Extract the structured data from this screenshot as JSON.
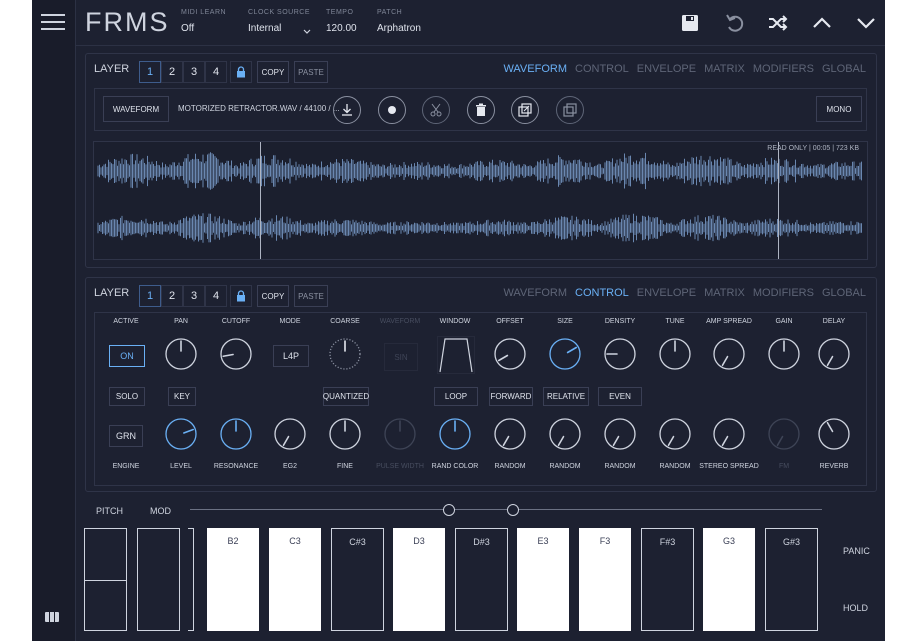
{
  "header": {
    "logo": "FRMS",
    "fields": [
      {
        "label": "MIDI LEARN",
        "value": "Off"
      },
      {
        "label": "CLOCK SOURCE",
        "value": "Internal"
      },
      {
        "label": "TEMPO",
        "value": "120.00"
      },
      {
        "label": "PATCH",
        "value": "Arphatron"
      }
    ]
  },
  "layer_top": {
    "label": "LAYER",
    "numbers": [
      "1",
      "2",
      "3",
      "4"
    ],
    "copy": "COPY",
    "paste": "PASTE",
    "tabs": [
      "WAVEFORM",
      "CONTROL",
      "ENVELOPE",
      "MATRIX",
      "MODIFIERS",
      "GLOBAL"
    ],
    "selected_tab": "WAVEFORM"
  },
  "waveform": {
    "button": "WAVEFORM",
    "file": "MOTORIZED RETRACTOR.WAV / 44100 / ...",
    "mono": "MONO",
    "info": "READ ONLY  |  00:05  |  723 KB"
  },
  "layer_bottom": {
    "label": "LAYER",
    "numbers": [
      "1",
      "2",
      "3",
      "4"
    ],
    "copy": "COPY",
    "paste": "PASTE",
    "tabs": [
      "WAVEFORM",
      "CONTROL",
      "ENVELOPE",
      "MATRIX",
      "MODIFIERS",
      "GLOBAL"
    ],
    "selected_tab": "CONTROL"
  },
  "control": {
    "top_labels": [
      "ACTIVE",
      "PAN",
      "CUTOFF",
      "MODE",
      "COARSE",
      "WAVEFORM",
      "WINDOW",
      "OFFSET",
      "SIZE",
      "DENSITY",
      "TUNE",
      "AMP SPREAD",
      "GAIN",
      "DELAY"
    ],
    "on": "ON",
    "mode": "L4P",
    "sin": "SIN",
    "solo": "SOLO",
    "key": "KEY",
    "quantized": "QUANTIZED",
    "loop": "LOOP",
    "forward": "FORWARD",
    "relative": "RELATIVE",
    "even": "EVEN",
    "grn": "GRN",
    "bottom_labels": [
      "ENGINE",
      "LEVEL",
      "RESONANCE",
      "EG2",
      "FINE",
      "PULSE WIDTH",
      "RAND COLOR",
      "RANDOM",
      "RANDOM",
      "RANDOM",
      "RANDOM",
      "STEREO SPREAD",
      "FM",
      "REVERB"
    ]
  },
  "keyboard": {
    "pitch": "PITCH",
    "mod": "MOD",
    "keys": [
      "B2",
      "C3",
      "C#3",
      "D3",
      "D#3",
      "E3",
      "F3",
      "F#3",
      "G3",
      "G#3"
    ],
    "panic": "PANIC",
    "hold": "HOLD"
  },
  "colors": {
    "accent": "#6ab0f5",
    "background": "#1d2131",
    "wave": "#6a87b0"
  }
}
